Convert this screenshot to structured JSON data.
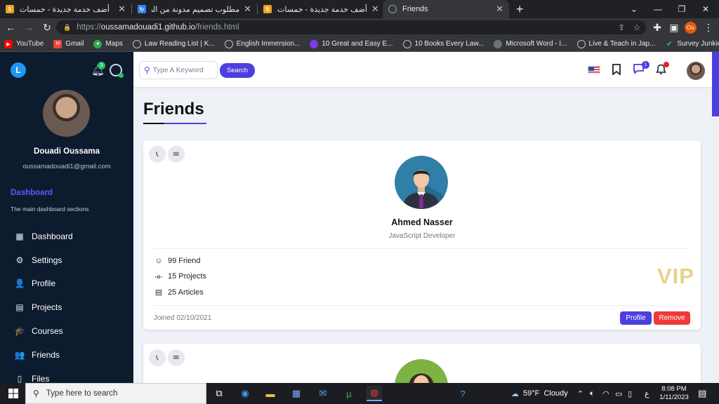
{
  "browser": {
    "tabs": [
      {
        "title": "أضف خدمة جديدة - خمسات",
        "favicon": "khamsat-icon",
        "color": "#f0a020",
        "active": false
      },
      {
        "title": "مطلوب تصميم مدونة من الصفر |",
        "favicon": "refresh-icon",
        "color": "#3b82f6",
        "active": false
      },
      {
        "title": "أضف خدمة جديدة - خمسات",
        "favicon": "khamsat-icon",
        "color": "#f0a020",
        "active": false
      },
      {
        "title": "Friends",
        "favicon": "globe-icon",
        "color": "#9aa0a6",
        "active": true
      }
    ],
    "close_glyph": "✕",
    "new_tab_glyph": "+",
    "url_prefix": "https://",
    "url_host": "oussamadouadi1.github.io",
    "url_path": "/friends.html",
    "profile_initials": "Ou",
    "bookmarks": [
      {
        "label": "YouTube",
        "icon": "youtube-icon",
        "color": "#ff0000"
      },
      {
        "label": "Gmail",
        "icon": "gmail-icon",
        "color": "#ea4335"
      },
      {
        "label": "Maps",
        "icon": "maps-icon",
        "color": "#34a853"
      },
      {
        "label": "Law Reading List | K...",
        "icon": "globe-icon",
        "color": "#5f6368"
      },
      {
        "label": "English Immersion...",
        "icon": "globe-icon",
        "color": "#5f6368"
      },
      {
        "label": "10 Great and Easy E...",
        "icon": "site-icon",
        "color": "#7c3aed"
      },
      {
        "label": "10 Books Every Law...",
        "icon": "globe-icon",
        "color": "#5f6368"
      },
      {
        "label": "Microsoft Word - I...",
        "icon": "site-icon",
        "color": "#6b7280"
      },
      {
        "label": "Live & Teach in Jap...",
        "icon": "globe-icon",
        "color": "#5f6368"
      },
      {
        "label": "Survey Junkie",
        "icon": "check-icon",
        "color": "#22c55e"
      }
    ]
  },
  "sidebar": {
    "logo_letter": "L",
    "notification_count": "3",
    "user_name": "Douadi Oussama",
    "user_email": "oussamadouadi1@gmail.com",
    "section_title": "Dashboard",
    "section_desc": "The main dashboard sections",
    "items": [
      {
        "label": "Dashboard",
        "icon": "dashboard-icon",
        "glyph": "▦"
      },
      {
        "label": "Settings",
        "icon": "settings-icon",
        "glyph": "⚙"
      },
      {
        "label": "Profile",
        "icon": "profile-icon",
        "glyph": "👤"
      },
      {
        "label": "Projects",
        "icon": "projects-icon",
        "glyph": "▤"
      },
      {
        "label": "Courses",
        "icon": "courses-icon",
        "glyph": "🎓"
      },
      {
        "label": "Friends",
        "icon": "friends-icon",
        "glyph": "👥"
      },
      {
        "label": "Files",
        "icon": "files-icon",
        "glyph": "▯"
      }
    ]
  },
  "topbar": {
    "search_placeholder": "Type A Keyword",
    "search_button": "Search",
    "messages_count": "1"
  },
  "main": {
    "title": "Friends",
    "cards": [
      {
        "name": "Ahmed Nasser",
        "role": "JavaScript Developer",
        "stats": [
          {
            "icon": "smile-icon",
            "glyph": "☺",
            "label": "99 Friend"
          },
          {
            "icon": "commit-icon",
            "glyph": "-o-",
            "label": "15 Projects"
          },
          {
            "icon": "newspaper-icon",
            "glyph": "▤",
            "label": "25 Articles"
          }
        ],
        "badge": "VIP",
        "joined": "Joined 02/10/2021",
        "profile_button": "Profile",
        "remove_button": "Remove"
      }
    ]
  },
  "taskbar": {
    "search_placeholder": "Type here to search",
    "weather": "59°F  Cloudy",
    "lang": "ع",
    "time": "8:08 PM",
    "date": "1/11/2023"
  }
}
